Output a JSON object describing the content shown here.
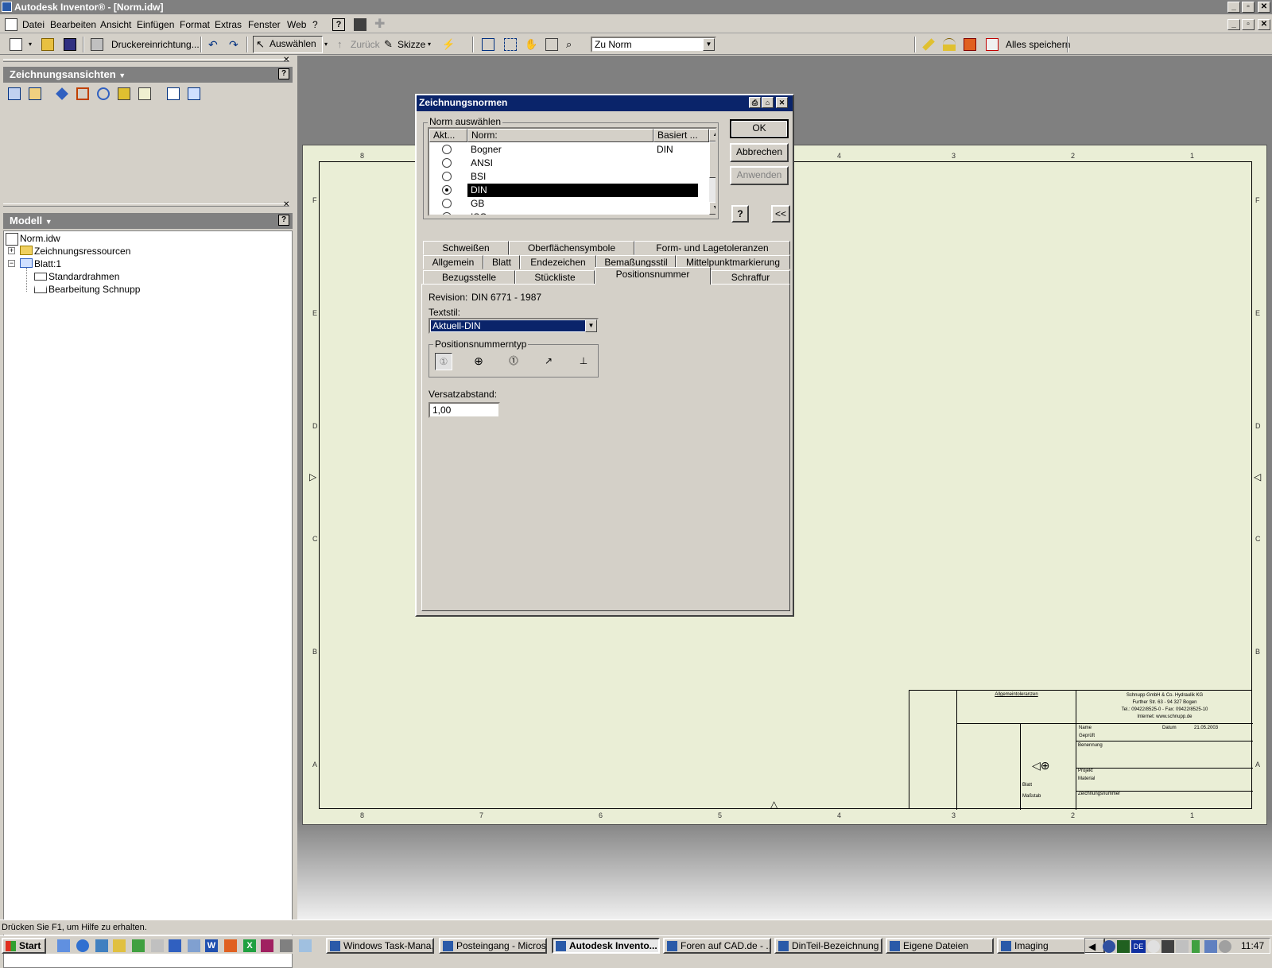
{
  "window": {
    "title": "Autodesk Inventor® - [Norm.idw]"
  },
  "menu": [
    "Datei",
    "Bearbeiten",
    "Ansicht",
    "Einfügen",
    "Format",
    "Extras",
    "Fenster",
    "Web",
    "?"
  ],
  "toolbar": {
    "print_setup": "Druckereinrichtung...",
    "select": "Auswählen",
    "back": "Zurück",
    "sketch": "Skizze",
    "norm_combo": "Zu Norm",
    "save_all": "Alles speichern"
  },
  "panels": {
    "views_title": "Zeichnungsansichten",
    "model_title": "Modell",
    "help": "?",
    "tree": [
      {
        "label": "Norm.idw",
        "icon": "drawing-file-icon"
      },
      {
        "label": "Zeichnungsressourcen",
        "icon": "folder-icon"
      },
      {
        "label": "Blatt:1",
        "icon": "sheet-icon"
      },
      {
        "label": "Standardrahmen",
        "icon": "frame-icon"
      },
      {
        "label": "Bearbeitung Schnupp",
        "icon": "titleblock-icon"
      }
    ]
  },
  "dialog": {
    "title": "Zeichnungsnormen",
    "group_label": "Norm auswählen",
    "columns": [
      "Akt...",
      "Norm:",
      "Basiert ..."
    ],
    "rows": [
      {
        "active": false,
        "name": "Bogner",
        "based": "DIN",
        "selected": false
      },
      {
        "active": false,
        "name": "ANSI",
        "based": "",
        "selected": false
      },
      {
        "active": false,
        "name": "BSI",
        "based": "",
        "selected": false
      },
      {
        "active": true,
        "name": "DIN",
        "based": "",
        "selected": true
      },
      {
        "active": false,
        "name": "GB",
        "based": "",
        "selected": false
      },
      {
        "active": false,
        "name": "ISO",
        "based": "",
        "selected": false
      }
    ],
    "ok": "OK",
    "cancel": "Abbrechen",
    "apply": "Anwenden",
    "help": "?",
    "collapse": "<<",
    "tabs_row1": [
      "Schweißen",
      "Oberflächensymbole",
      "Form- und Lagetoleranzen"
    ],
    "tabs_row2": [
      "Allgemein",
      "Blatt",
      "Endezeichen",
      "Bemaßungsstil",
      "Mittelpunktmarkierung"
    ],
    "tabs_row3": [
      "Bezugsstelle",
      "Stückliste",
      "Positionsnummer",
      "Schraffur"
    ],
    "active_tab": "Positionsnummer",
    "revision_label": "Revision:",
    "revision_value": "DIN 6771 - 1987",
    "textstyle_label": "Textstil:",
    "textstyle_value": "Aktuell-DIN",
    "type_group": "Positionsnummerntyp",
    "offset_label": "Versatzabstand:",
    "offset_value": "1,00"
  },
  "sheet": {
    "col_labels": [
      "8",
      "7",
      "6",
      "5",
      "4",
      "3",
      "2",
      "1"
    ],
    "row_labels": [
      "F",
      "E",
      "D",
      "C",
      "B",
      "A"
    ],
    "titleblock": {
      "company": "Schnupp GmbH & Co. Hydraulik KG",
      "address": "Further Str. 63 - 94 327 Bogen",
      "phone": "Tel.: 09422/8525-0 - Fax: 09422/8525-10",
      "web": "Internet: www.schnupp.de",
      "general_tol": "Allgemeintoleranzen",
      "date_label": "Datum",
      "date_value": "21.05.2003",
      "name_label": "Name",
      "checked_label": "Geprüft",
      "designation": "Benennung",
      "project": "Projekt",
      "material": "Material",
      "drawing_no": "Zeichnungsnummer",
      "sheet_label": "Blatt",
      "scale_label": "Maßstab"
    }
  },
  "status": {
    "text": "Drücken Sie F1, um Hilfe zu erhalten."
  },
  "taskbar": {
    "start": "Start",
    "tasks": [
      {
        "label": "Windows Task-Mana...",
        "active": false
      },
      {
        "label": "Posteingang - Micros...",
        "active": false
      },
      {
        "label": "Autodesk Invento...",
        "active": true
      },
      {
        "label": "Foren auf CAD.de - ...",
        "active": false
      },
      {
        "label": "DinTeil-Bezeichnung ...",
        "active": false
      },
      {
        "label": "Eigene Dateien",
        "active": false
      },
      {
        "label": "Imaging",
        "active": false
      }
    ],
    "lang": "DE",
    "clock": "11:47"
  }
}
